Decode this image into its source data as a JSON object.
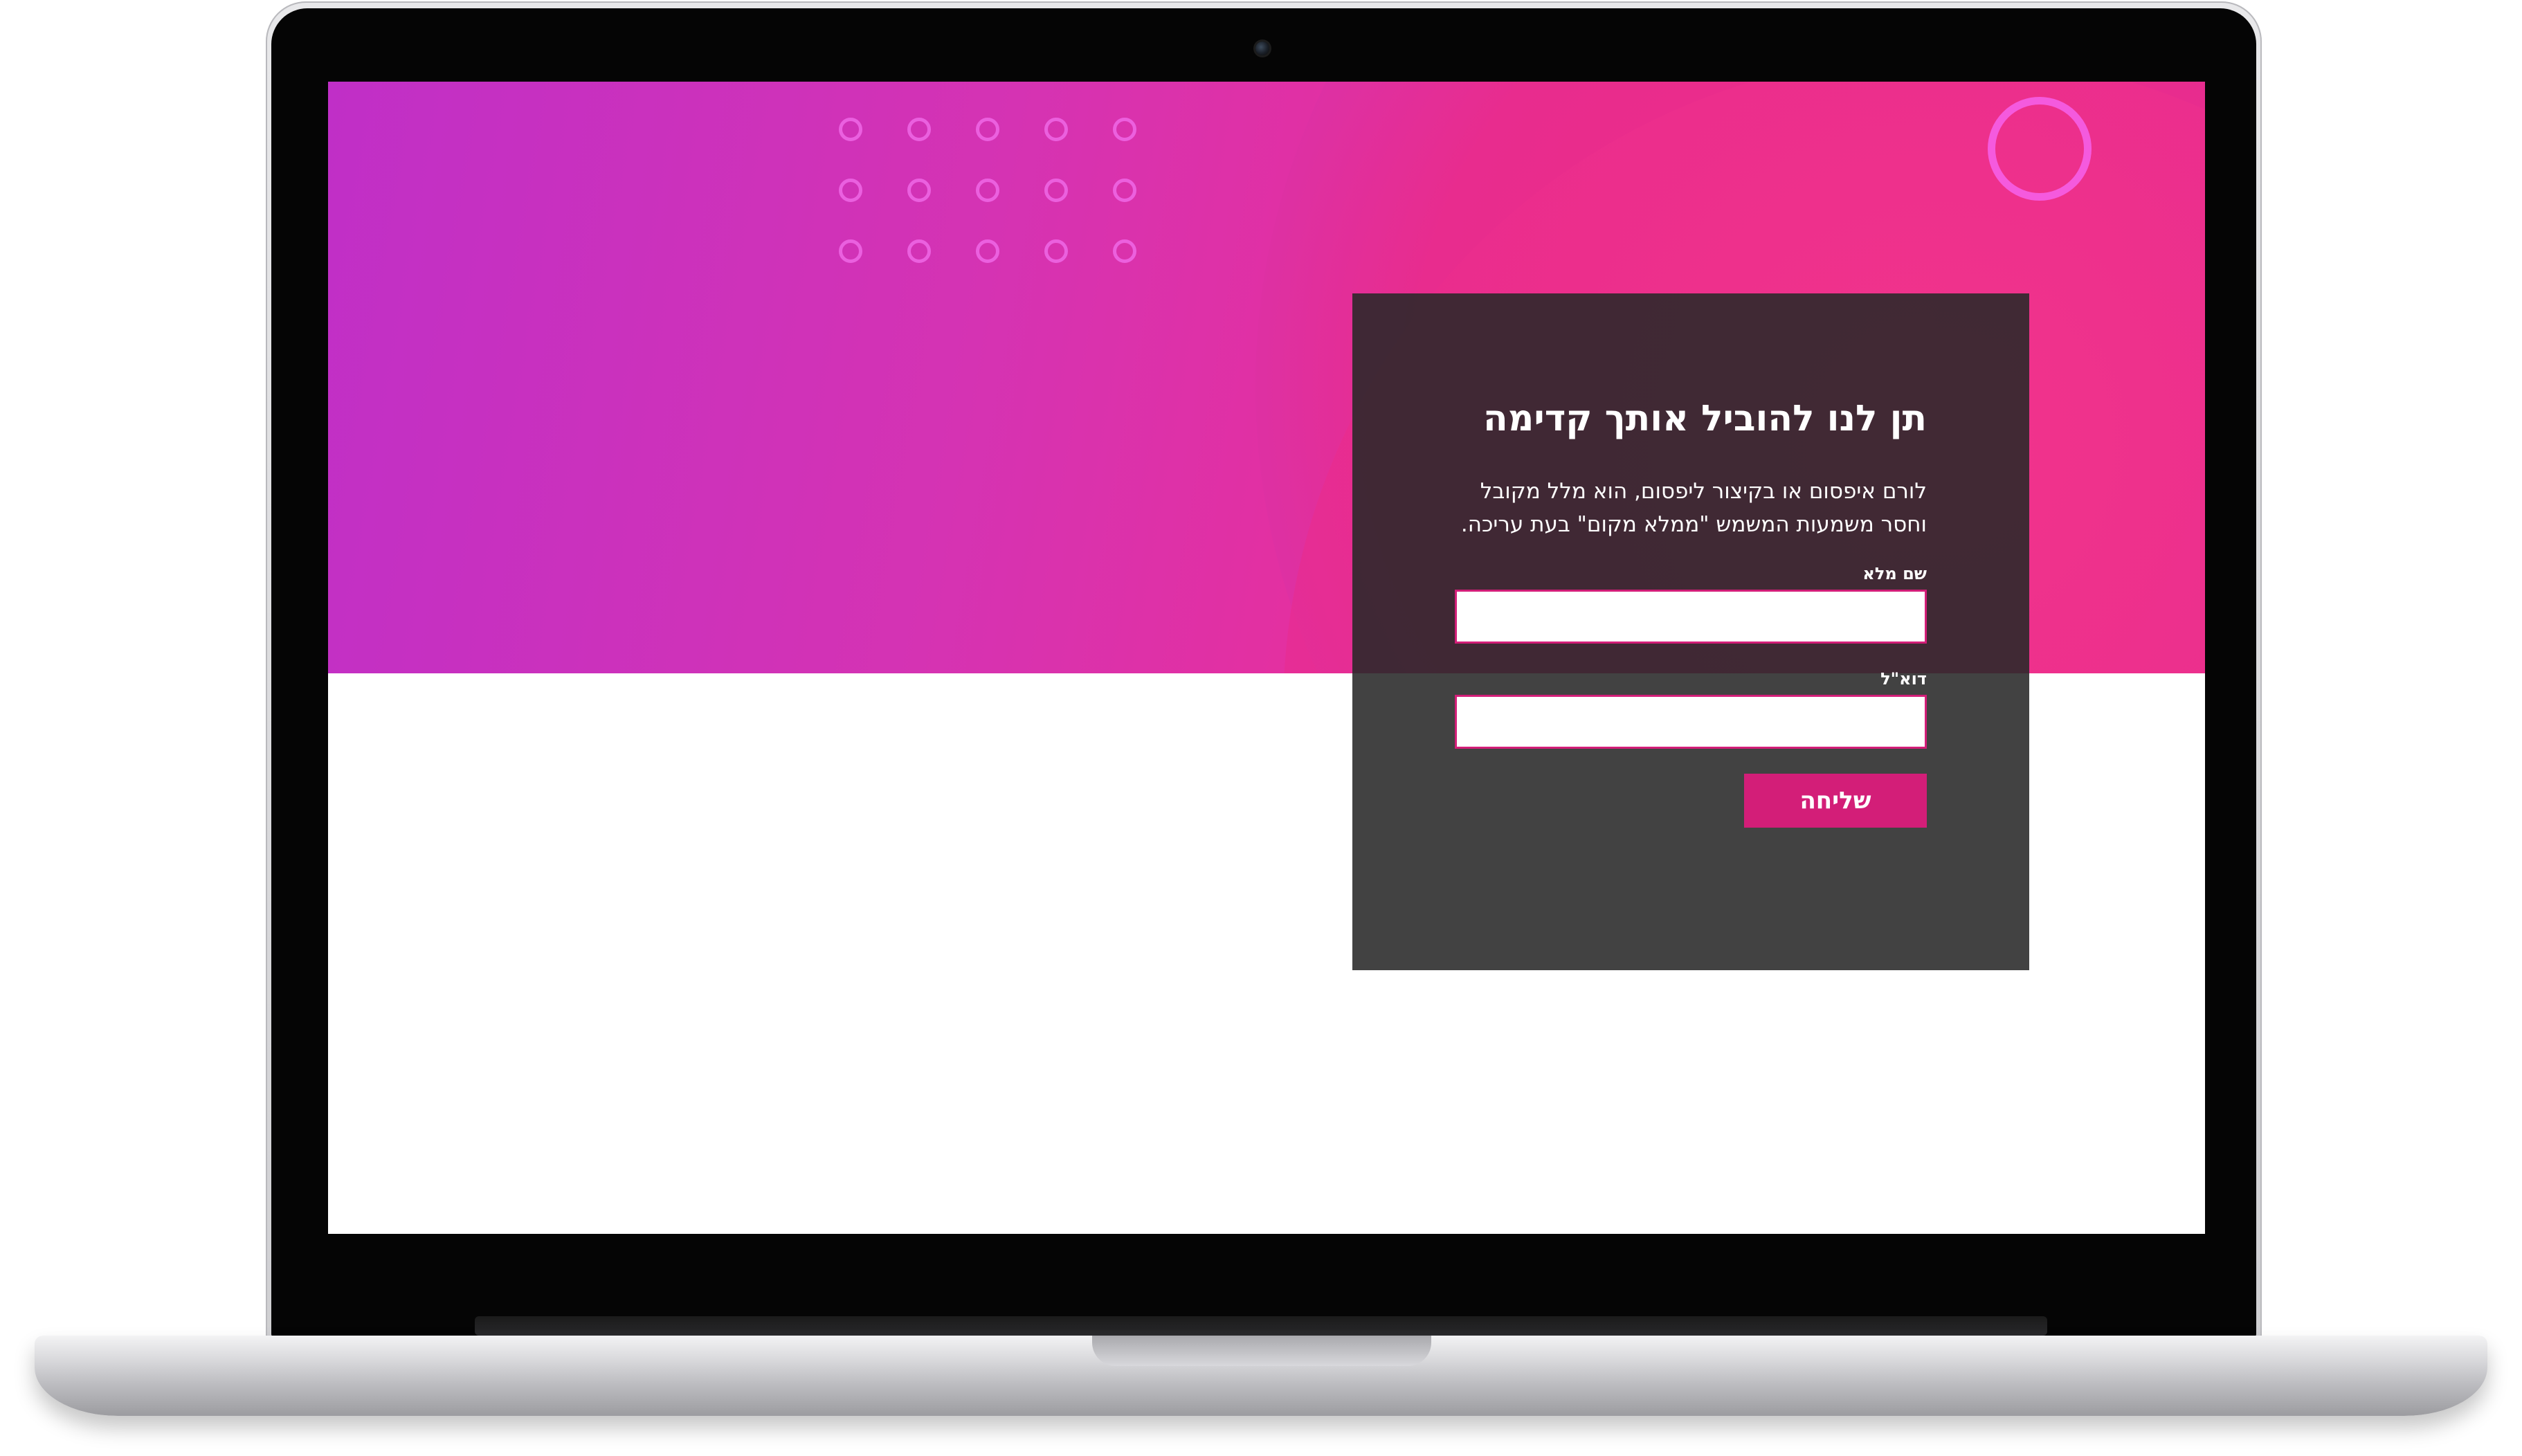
{
  "form": {
    "title": "תן לנו להוביל אותך קדימה",
    "description_line1": "לורם איפסום או בקיצור ליפסום, הוא מלל מקובל",
    "description_line2": "וחסר משמעות המשמש \"ממלא מקום\" בעת עריכה.",
    "name_label": "שם מלא",
    "name_value": "",
    "email_label": "דוא\"ל",
    "email_value": "",
    "submit_label": "שליחה"
  },
  "colors": {
    "hero_gradient_start": "#c02fc7",
    "hero_gradient_end": "#f0348c",
    "accent": "#d31e78",
    "card_background": "#282828",
    "decor_pink": "#ee68e6"
  },
  "decorations": {
    "dot_grid_rows": 3,
    "dot_grid_cols": 5
  }
}
